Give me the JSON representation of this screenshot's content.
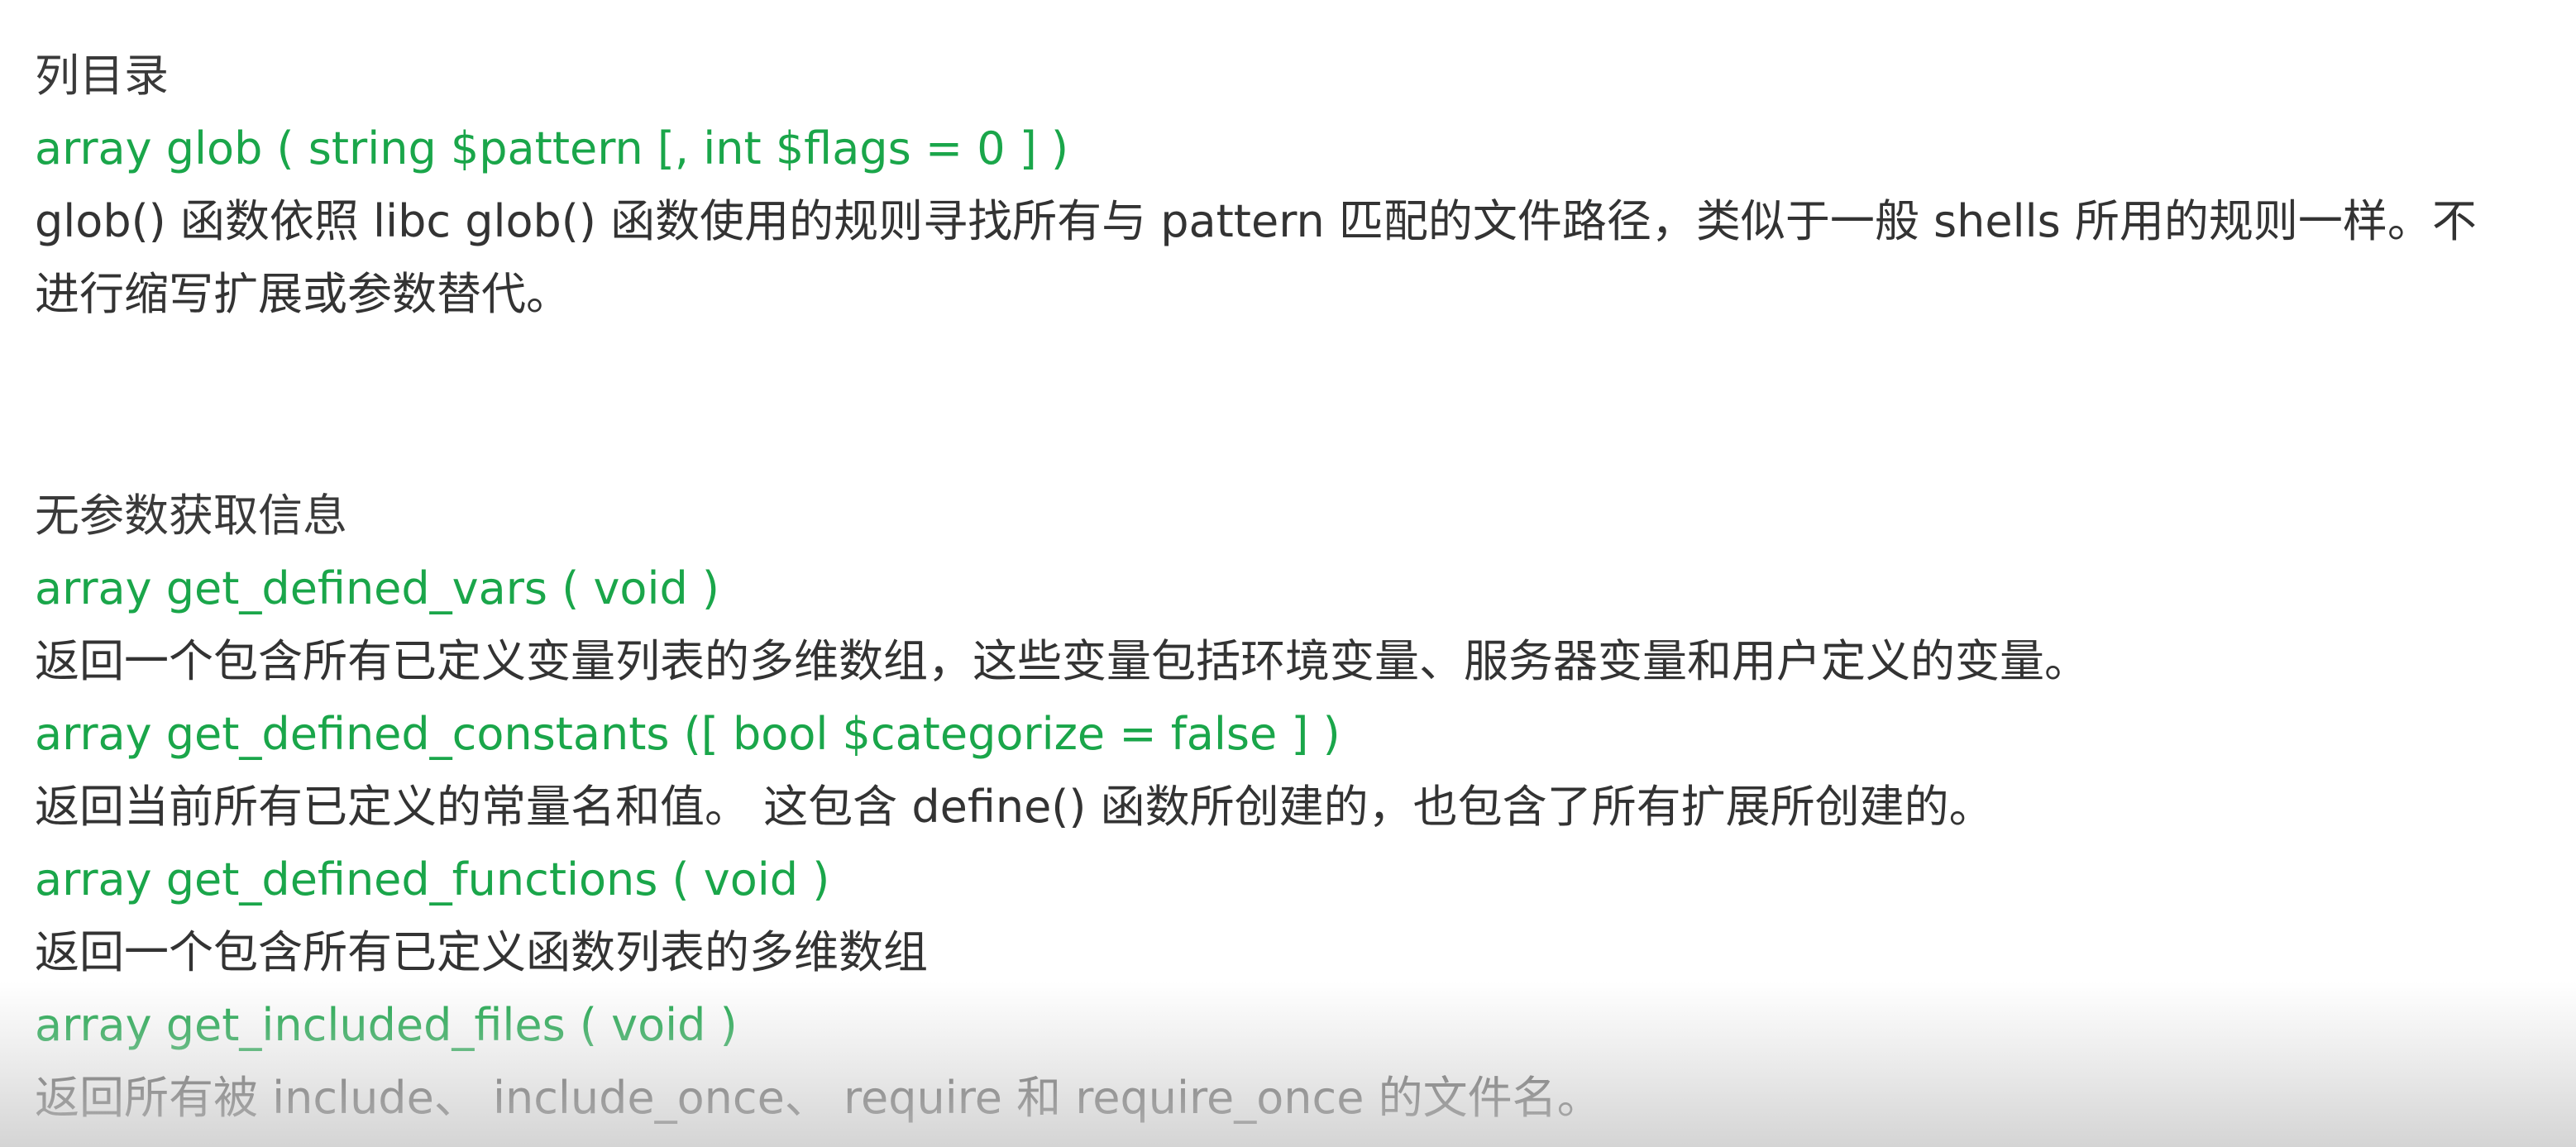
{
  "sections": [
    {
      "heading": "列目录",
      "entries": [
        {
          "signature": "array glob ( string $pattern [, int $flags = 0 ] )",
          "description": "glob() 函数依照 libc glob() 函数使用的规则寻找所有与 pattern 匹配的文件路径，类似于一般 shells 所用的规则一样。不进行缩写扩展或参数替代。"
        }
      ]
    },
    {
      "heading": "无参数获取信息",
      "entries": [
        {
          "signature": "array get_defined_vars ( void )",
          "description": "返回一个包含所有已定义变量列表的多维数组，这些变量包括环境变量、服务器变量和用户定义的变量。"
        },
        {
          "signature": "array get_defined_constants ([ bool $categorize = false ] )",
          "description": "返回当前所有已定义的常量名和值。 这包含 define() 函数所创建的，也包含了所有扩展所创建的。"
        },
        {
          "signature": "array get_defined_functions ( void )",
          "description": "返回一个包含所有已定义函数列表的多维数组"
        },
        {
          "signature": "array get_included_files ( void )",
          "description": "返回所有被 include、 include_once、 require 和 require_once 的文件名。"
        }
      ]
    }
  ],
  "colors": {
    "signature": "#1aa64a",
    "text": "#333333",
    "background": "#ffffff"
  }
}
